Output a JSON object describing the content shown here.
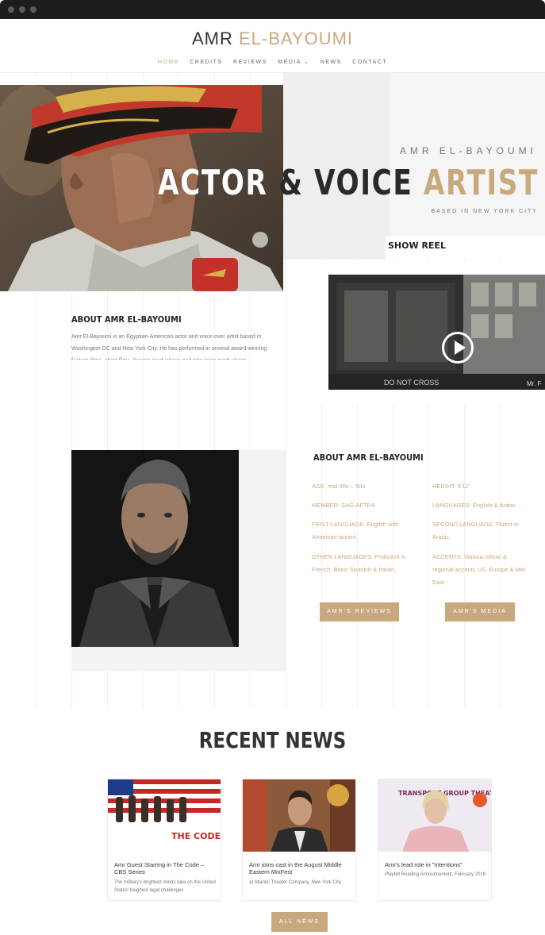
{
  "header": {
    "logo_first": "AMR",
    "logo_accent": "EL-BAYOUMI",
    "nav": [
      {
        "label": "HOME",
        "active": true
      },
      {
        "label": "CREDITS",
        "active": false
      },
      {
        "label": "REVIEWS",
        "active": false
      },
      {
        "label": "MEDIA ⌄",
        "active": false
      },
      {
        "label": "NEWS",
        "active": false
      },
      {
        "label": "CONTACT",
        "active": false
      }
    ]
  },
  "hero": {
    "kicker": "AMR EL-BAYOUMI",
    "title_word1": "ACTOR",
    "title_word2": "& VOICE",
    "title_word3": "ARTIST",
    "subtitle": "BASED IN NEW YORK CITY",
    "show_reel_label": "SHOW REEL",
    "video_overlay_text": "DO NOT CROSS",
    "video_corner_text": "Mr. F"
  },
  "about_intro": {
    "title": "ABOUT AMR EL-BAYOUMI",
    "text": "Amr El-Bayoumi is an Egyptian-American actor and voice-over artist based in Washington DC and New York City. He has performed in several award-winning feature films, short films, theater productions and television productions."
  },
  "about_details": {
    "title": "ABOUT AMR EL-BAYOUMI",
    "left": [
      "AGE: mid-30s – 50s",
      "MEMBER: SAG-AFTRA",
      "FIRST LANGUAGE: English with American accent.",
      "OTHER LANGUAGES:  Proficient in French. Basic Spanish & Italian."
    ],
    "right": [
      "HEIGHT: 5’11\"",
      "LANGUAGES: English & Arabic",
      "SECOND LANGUAGE: Fluent in Arabic.",
      "ACCENTS: Various ethnic & regional accents US, Europe & Mid East."
    ],
    "reviews_button": "AMR'S REVIEWS",
    "media_button": "AMR'S MEDIA"
  },
  "news": {
    "title": "RECENT NEWS",
    "items": [
      {
        "title": "Amr Guest Starring in The Code – CBS Series",
        "desc": "The military's brightest minds take on the United States' toughest legal challenges",
        "image_caption": "THE CODE"
      },
      {
        "title": "Amr joins cast in the August Middle Eastern MixFest",
        "desc": "at Atlantic Theater Company, New York City",
        "image_caption": ""
      },
      {
        "title": "Amr's lead role in \"Intentions\"",
        "desc": "Playbill Reading Announcement, February 2018",
        "image_caption": "TRANSPORT GROUP THEATRE COMPANY"
      }
    ],
    "all_button": "ALL NEWS"
  },
  "colors": {
    "accent": "#c8a97e",
    "dark": "#2a2a2a",
    "muted": "#777777",
    "browser_chrome": "#1d1d1f"
  }
}
